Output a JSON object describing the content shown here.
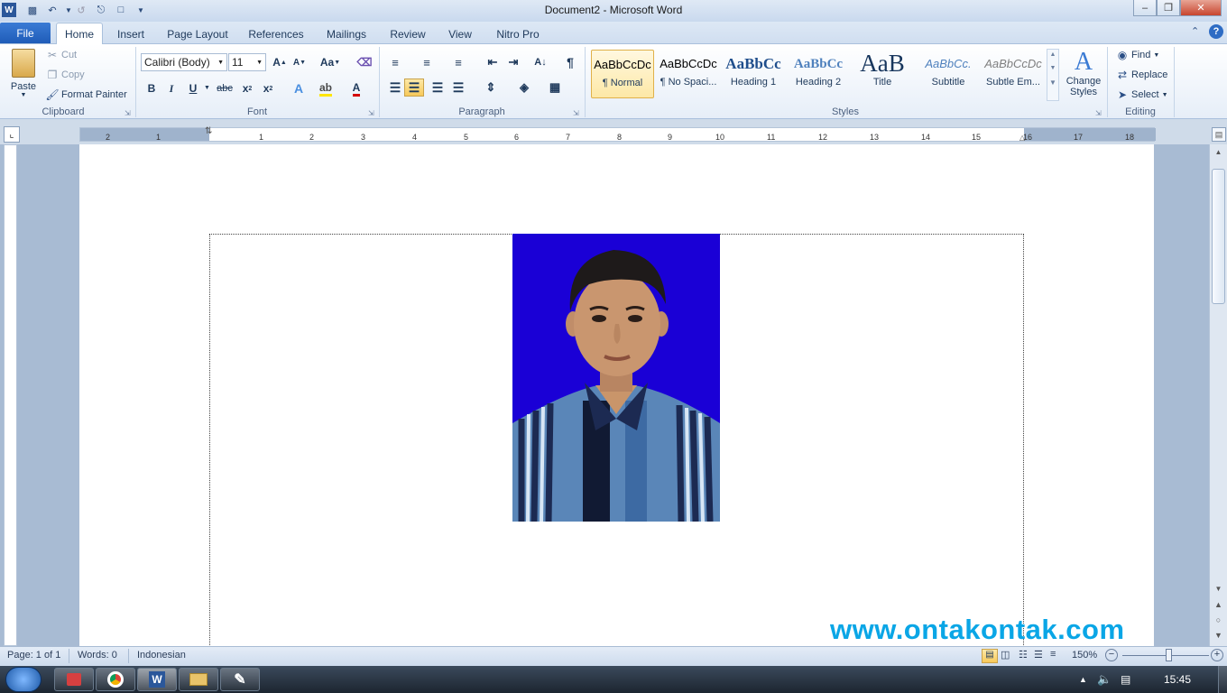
{
  "window": {
    "title": "Document2 - Microsoft Word"
  },
  "tabs": [
    "File",
    "Home",
    "Insert",
    "Page Layout",
    "References",
    "Mailings",
    "Review",
    "View",
    "Nitro Pro"
  ],
  "clipboard": {
    "paste": "Paste",
    "cut": "Cut",
    "copy": "Copy",
    "format_painter": "Format Painter",
    "label": "Clipboard"
  },
  "font": {
    "name": "Calibri (Body)",
    "size": "11",
    "label": "Font",
    "case_label": "Aa"
  },
  "paragraph": {
    "label": "Paragraph"
  },
  "styles": {
    "label": "Styles",
    "items": [
      {
        "sample": "AaBbCcDc",
        "name": "¶ Normal"
      },
      {
        "sample": "AaBbCcDc",
        "name": "¶ No Spaci..."
      },
      {
        "sample": "AaBbCc",
        "name": "Heading 1"
      },
      {
        "sample": "AaBbCc",
        "name": "Heading 2"
      },
      {
        "sample": "AaB",
        "name": "Title"
      },
      {
        "sample": "AaBbCc.",
        "name": "Subtitle"
      },
      {
        "sample": "AaBbCcDc",
        "name": "Subtle Em..."
      }
    ],
    "change_styles": "Change Styles"
  },
  "editing": {
    "find": "Find",
    "replace": "Replace",
    "select": "Select",
    "label": "Editing"
  },
  "ruler": {
    "ticks": [
      "2",
      "1",
      "1",
      "2",
      "3",
      "4",
      "5",
      "6",
      "7",
      "8",
      "9",
      "10",
      "11",
      "12",
      "13",
      "14",
      "15",
      "16",
      "17",
      "18"
    ]
  },
  "document": {
    "watermark": "www.ontakontak.com"
  },
  "status": {
    "page": "Page: 1 of 1",
    "words": "Words: 0",
    "language": "Indonesian",
    "zoom": "150%"
  },
  "taskbar": {
    "time": "15:45"
  },
  "colors": {
    "accent": "#1f5cb8",
    "photo_bg": "#1a00d6",
    "watermark": "#0aa6e6"
  }
}
